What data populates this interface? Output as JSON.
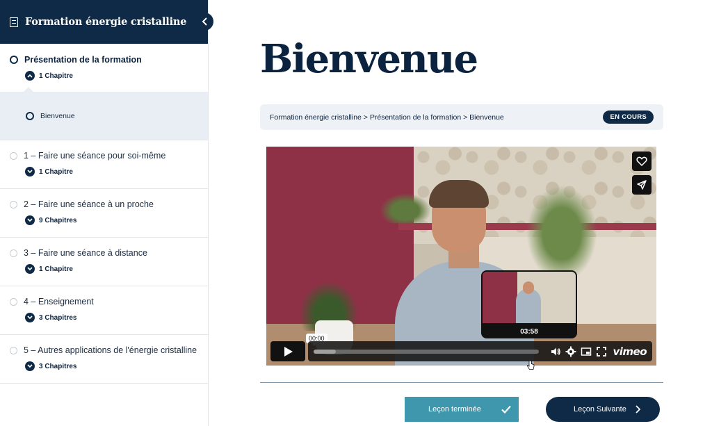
{
  "sidebar": {
    "course_title": "Formation énergie cristalline",
    "sections": [
      {
        "title": "Présentation de la formation",
        "count": "1 Chapitre",
        "active": true
      },
      {
        "title": "1 – Faire une séance pour soi-même",
        "count": "1 Chapitre"
      },
      {
        "title": "2 – Faire une séance à un proche",
        "count": "9 Chapitres"
      },
      {
        "title": "3 – Faire une séance à distance",
        "count": "1 Chapitre"
      },
      {
        "title": "4 – Enseignement",
        "count": "3 Chapitres"
      },
      {
        "title": "5 – Autres applications de l'énergie cristalline",
        "count": "3 Chapitres"
      }
    ],
    "current_lesson": "Bienvenue"
  },
  "main": {
    "title": "Bienvenue",
    "breadcrumb": "Formation énergie cristalline > Présentation de la formation > Bienvenue",
    "status_badge": "EN COURS"
  },
  "video": {
    "current_time": "00:00",
    "preview_time": "03:58",
    "progress": 0.0,
    "brand": "vimeo"
  },
  "actions": {
    "complete_label": "Leçon terminée",
    "next_label": "Leçon Suivante"
  },
  "colors": {
    "navy": "#0f2a47",
    "teal": "#3f97ad",
    "light_panel": "#e8eef4"
  }
}
